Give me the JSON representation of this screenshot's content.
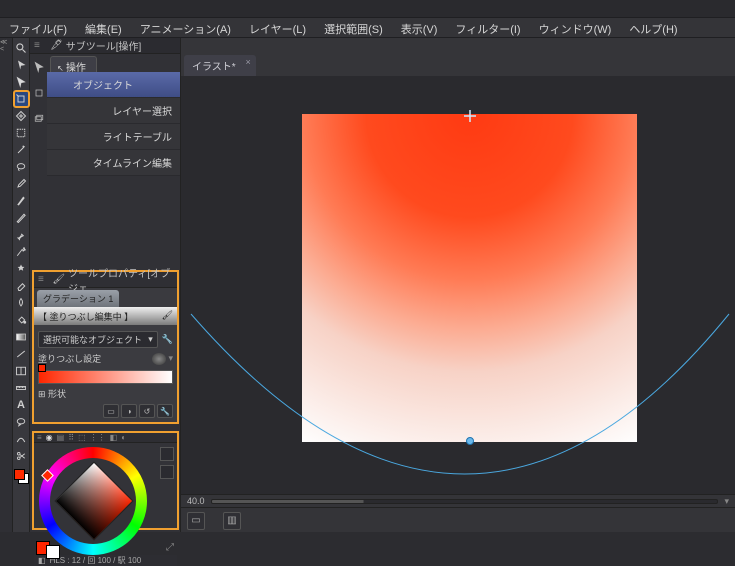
{
  "title": "",
  "menus": [
    {
      "label": "ファイル(F)"
    },
    {
      "label": "編集(E)"
    },
    {
      "label": "アニメーション(A)"
    },
    {
      "label": "レイヤー(L)"
    },
    {
      "label": "選択範囲(S)"
    },
    {
      "label": "表示(V)"
    },
    {
      "label": "フィルター(I)"
    },
    {
      "label": "ウィンドウ(W)"
    },
    {
      "label": "ヘルプ(H)"
    }
  ],
  "subtool": {
    "title": "サブツール[操作]",
    "tab": "操作",
    "items": [
      {
        "label": "オブジェクト"
      },
      {
        "label": "レイヤー選択"
      },
      {
        "label": "ライトテーブル"
      },
      {
        "label": "タイムライン編集"
      }
    ]
  },
  "tool_property": {
    "title": "ツールプロパティ[オブジェ",
    "tab": "グラデーション 1",
    "editing": "【 塗りつぶし編集中 】",
    "selectable": "選択可能なオブジェクト",
    "fill_label": "塗りつぶし設定",
    "shape_label": "形状"
  },
  "canvas": {
    "tab": "イラスト*",
    "zoom": "40.0"
  },
  "color": {
    "readout": "HLS : 12 / 回 100 / 駅 100",
    "main": "#ff2600",
    "sub": "#ffffff"
  }
}
